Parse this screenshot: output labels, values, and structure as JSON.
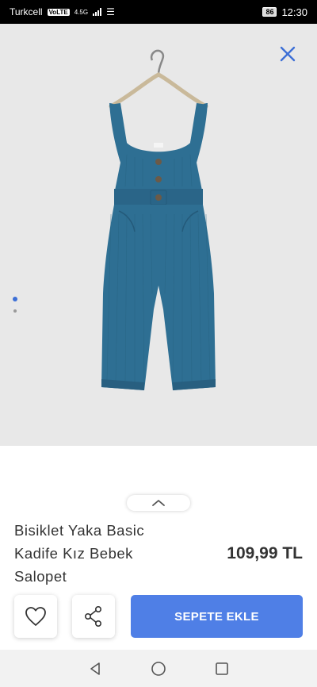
{
  "status_bar": {
    "carrier": "Turkcell",
    "volte": "VoLTE",
    "network": "4.5G",
    "battery": "86",
    "time": "12:30"
  },
  "gallery": {
    "image_count": 2,
    "active_index": 0
  },
  "product": {
    "name": "Bisiklet Yaka Basic Kadife Kız Bebek Salopet",
    "price": "109,99 TL"
  },
  "actions": {
    "add_to_cart_label": "SEPETE EKLE"
  },
  "colors": {
    "accent": "#4f7fe6",
    "text": "#333333",
    "garment": "#2e6f93"
  },
  "icons": {
    "close": "close-icon",
    "expand": "chevron-up-icon",
    "favorite": "heart-icon",
    "share": "share-icon",
    "back": "back-triangle-icon",
    "home": "home-circle-icon",
    "recents": "recents-square-icon"
  }
}
